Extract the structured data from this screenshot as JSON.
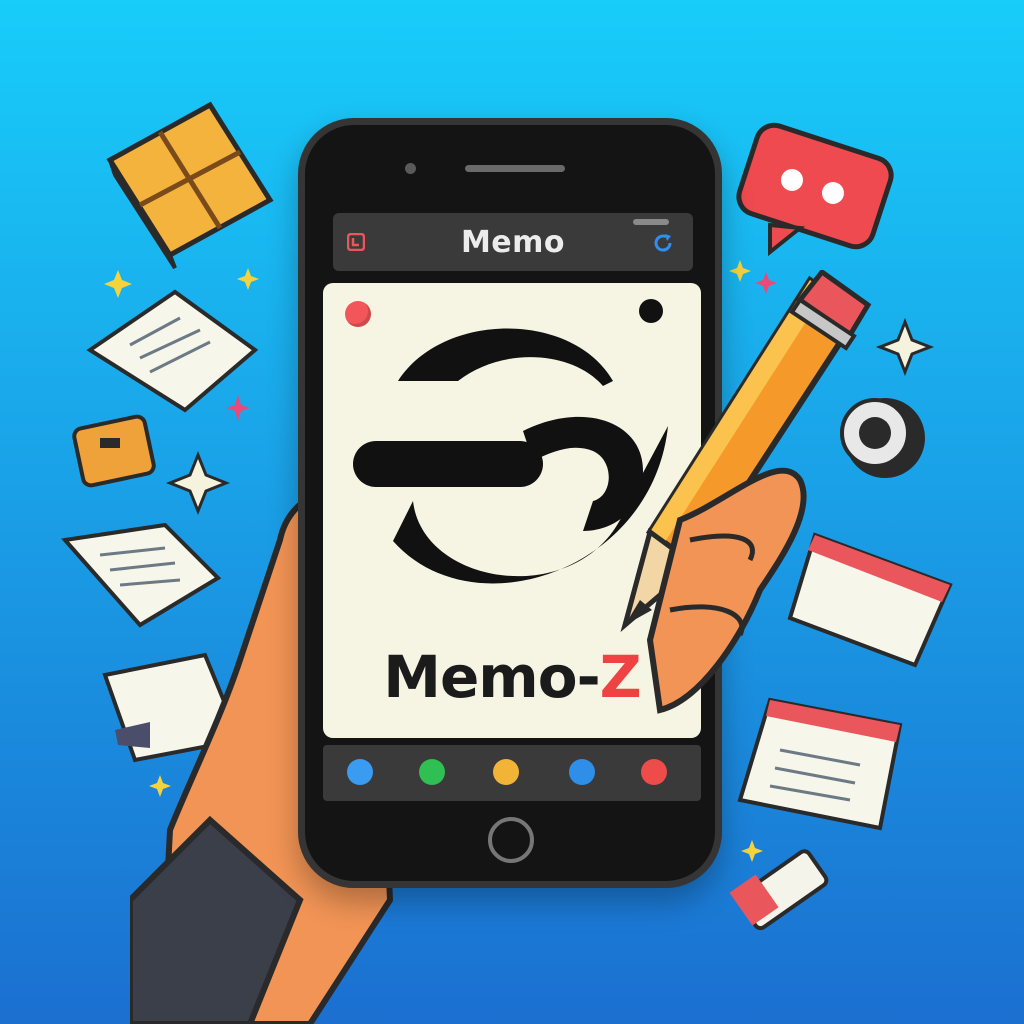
{
  "app": {
    "bar_title": "Memo",
    "name_main": "Memo-",
    "name_accent": "Z"
  },
  "colors": {
    "background_top": "#18cdfa",
    "background_bottom": "#1b6fd0",
    "accent_red": "#ef4242",
    "phone_body": "#141414",
    "screen": "#f6f5e4"
  },
  "nav_icons": [
    {
      "name": "location-icon",
      "color": "#3a9cf0"
    },
    {
      "name": "refresh-icon",
      "color": "#2fbf53"
    },
    {
      "name": "folder-icon",
      "color": "#f2b437"
    },
    {
      "name": "bird-icon",
      "color": "#2f8ee8"
    },
    {
      "name": "pin-icon",
      "color": "#ee4b4b"
    }
  ]
}
